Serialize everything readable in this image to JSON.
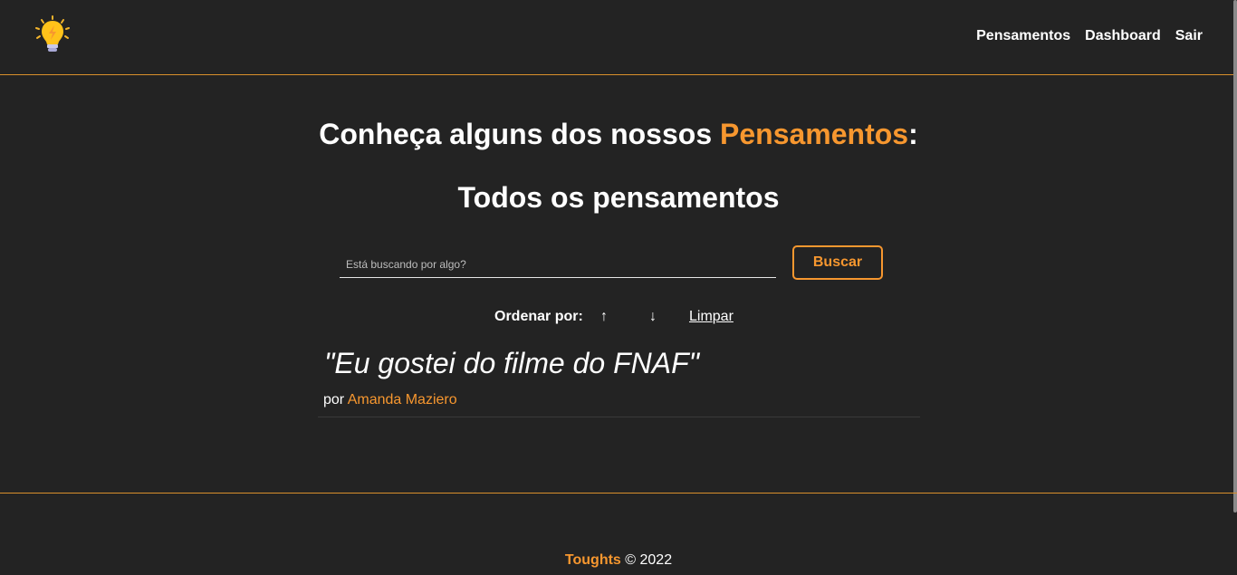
{
  "nav": {
    "logo_icon": "lightbulb-icon",
    "links": [
      "Pensamentos",
      "Dashboard",
      "Sair"
    ]
  },
  "heading": {
    "prefix": "Conheça alguns dos nossos ",
    "accent": "Pensamentos",
    "suffix": ":"
  },
  "section_title": "Todos os pensamentos",
  "search": {
    "placeholder": "Está buscando por algo?",
    "value": "",
    "button_label": "Buscar"
  },
  "order": {
    "label": "Ordenar por:",
    "asc_symbol": "↑",
    "desc_symbol": "↓",
    "clear_label": "Limpar"
  },
  "thoughts": [
    {
      "text": "\"Eu gostei do filme do FNAF\"",
      "author_prefix": "por ",
      "author": "Amanda Maziero"
    }
  ],
  "footer": {
    "brand": "Toughts",
    "copyright": " © 2022"
  },
  "colors": {
    "background": "#232323",
    "accent": "#f7972f",
    "divider": "#d98f2c"
  }
}
